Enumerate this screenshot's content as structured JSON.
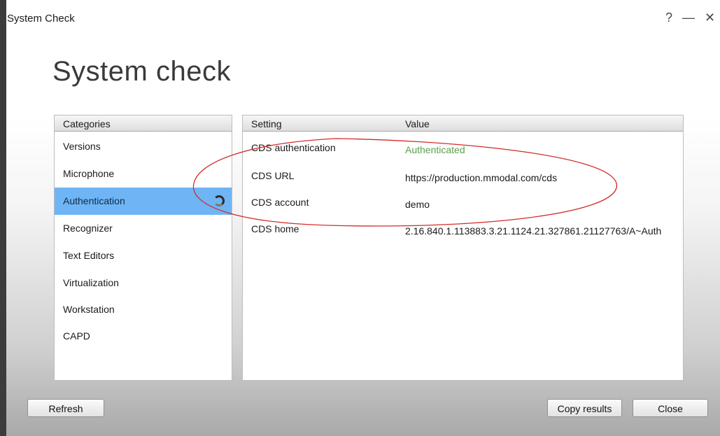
{
  "window": {
    "title": "System Check",
    "help_label": "?",
    "minimize_label": "—",
    "close_label": "✕"
  },
  "page": {
    "heading": "System check"
  },
  "categories": {
    "header": "Categories",
    "items": [
      {
        "label": "Versions"
      },
      {
        "label": "Microphone"
      },
      {
        "label": "Authentication",
        "selected": true,
        "loading": true
      },
      {
        "label": "Recognizer"
      },
      {
        "label": "Text Editors"
      },
      {
        "label": "Virtualization"
      },
      {
        "label": "Workstation"
      },
      {
        "label": "CAPD"
      }
    ]
  },
  "settings": {
    "header_setting": "Setting",
    "header_value": "Value",
    "rows": [
      {
        "setting": "CDS authentication",
        "value": "Authenticated",
        "value_color": "#5b9f4c"
      },
      {
        "setting": "CDS URL",
        "value": "https://production.mmodal.com/cds"
      },
      {
        "setting": "CDS account",
        "value": "demo"
      },
      {
        "setting": "CDS home",
        "value": "2.16.840.1.113883.3.21.1124.21.327861.21127763/A~Auth"
      }
    ]
  },
  "buttons": {
    "refresh": "Refresh",
    "copy_results": "Copy results",
    "close": "Close"
  },
  "colors": {
    "selection": "#6fb5f5",
    "annotation": "#d42b2b",
    "authenticated": "#5b9f4c"
  },
  "icons": {
    "spinner": "loading-spinner-icon",
    "annotation": "red-ellipse-annotation"
  }
}
